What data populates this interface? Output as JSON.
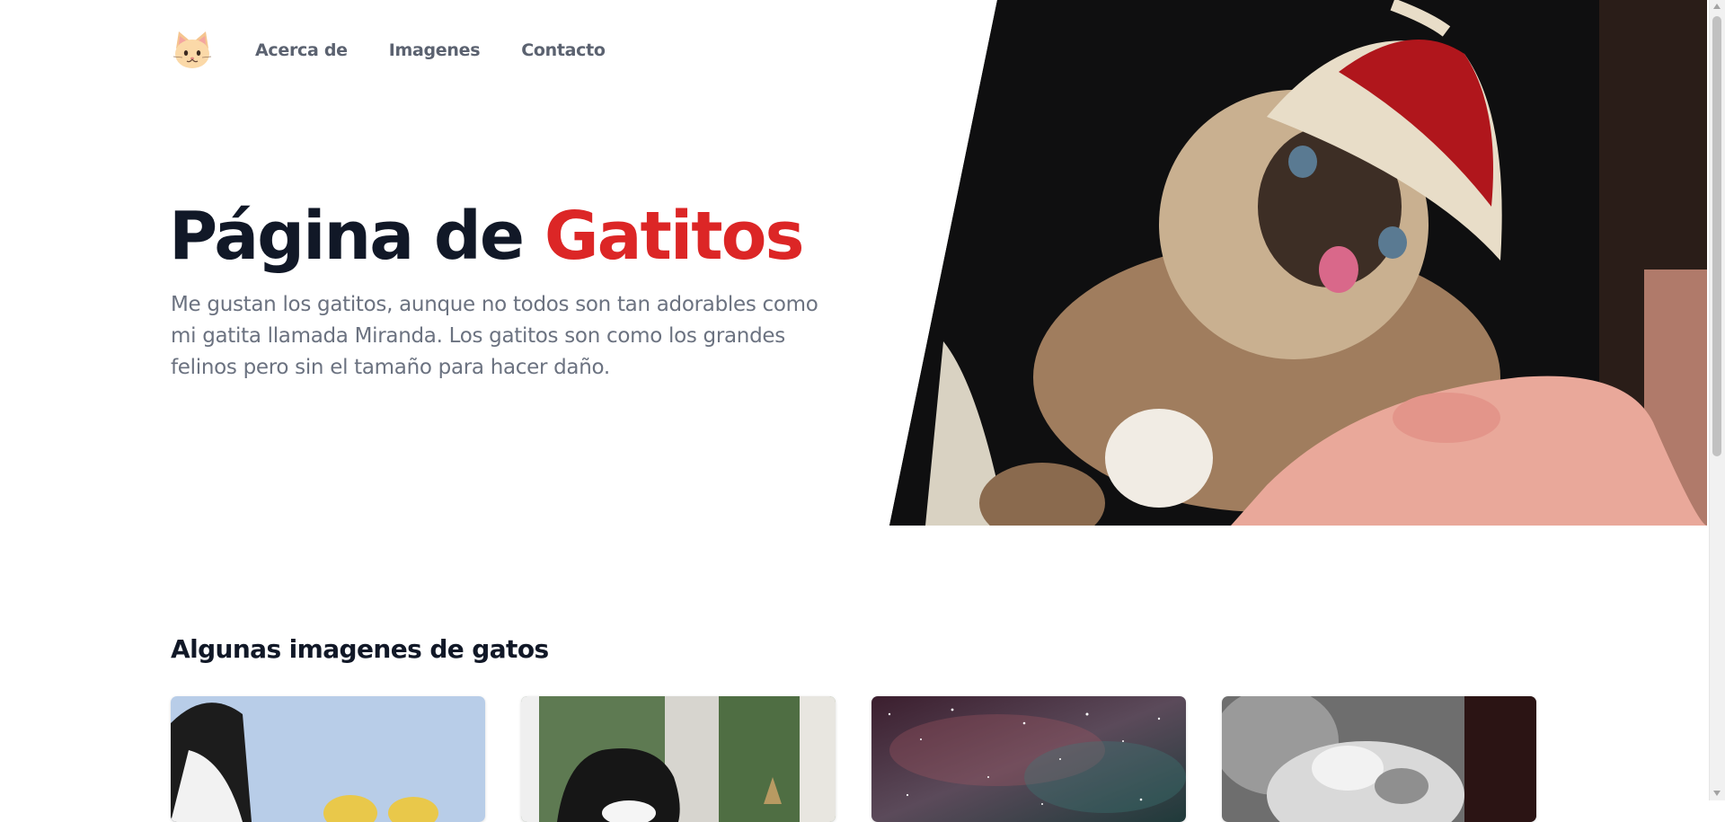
{
  "nav": {
    "logo_icon": "cat-face-icon",
    "links": [
      {
        "label": "Acerca de"
      },
      {
        "label": "Imagenes"
      },
      {
        "label": "Contacto"
      }
    ]
  },
  "hero": {
    "title_prefix": "Página de",
    "title_accent": "Gatitos",
    "description": "Me gustan los gatitos, aunque no todos son tan adorables como mi gatita llamada Miranda. Los gatitos son como los grandes felinos pero sin el tamaño para hacer daño.",
    "image_subject": "siamese-kitten-with-knit-hat-photo",
    "accent_color": "#dc2626",
    "title_color": "#111827"
  },
  "gallery": {
    "title": "Algunas imagenes de gatos",
    "cards": [
      {
        "image": "black-white-cat-sky-photo"
      },
      {
        "image": "black-white-cat-window-photo"
      },
      {
        "image": "cat-space-nebula-photo"
      },
      {
        "image": "grey-kitten-sleeping-photo"
      }
    ]
  }
}
